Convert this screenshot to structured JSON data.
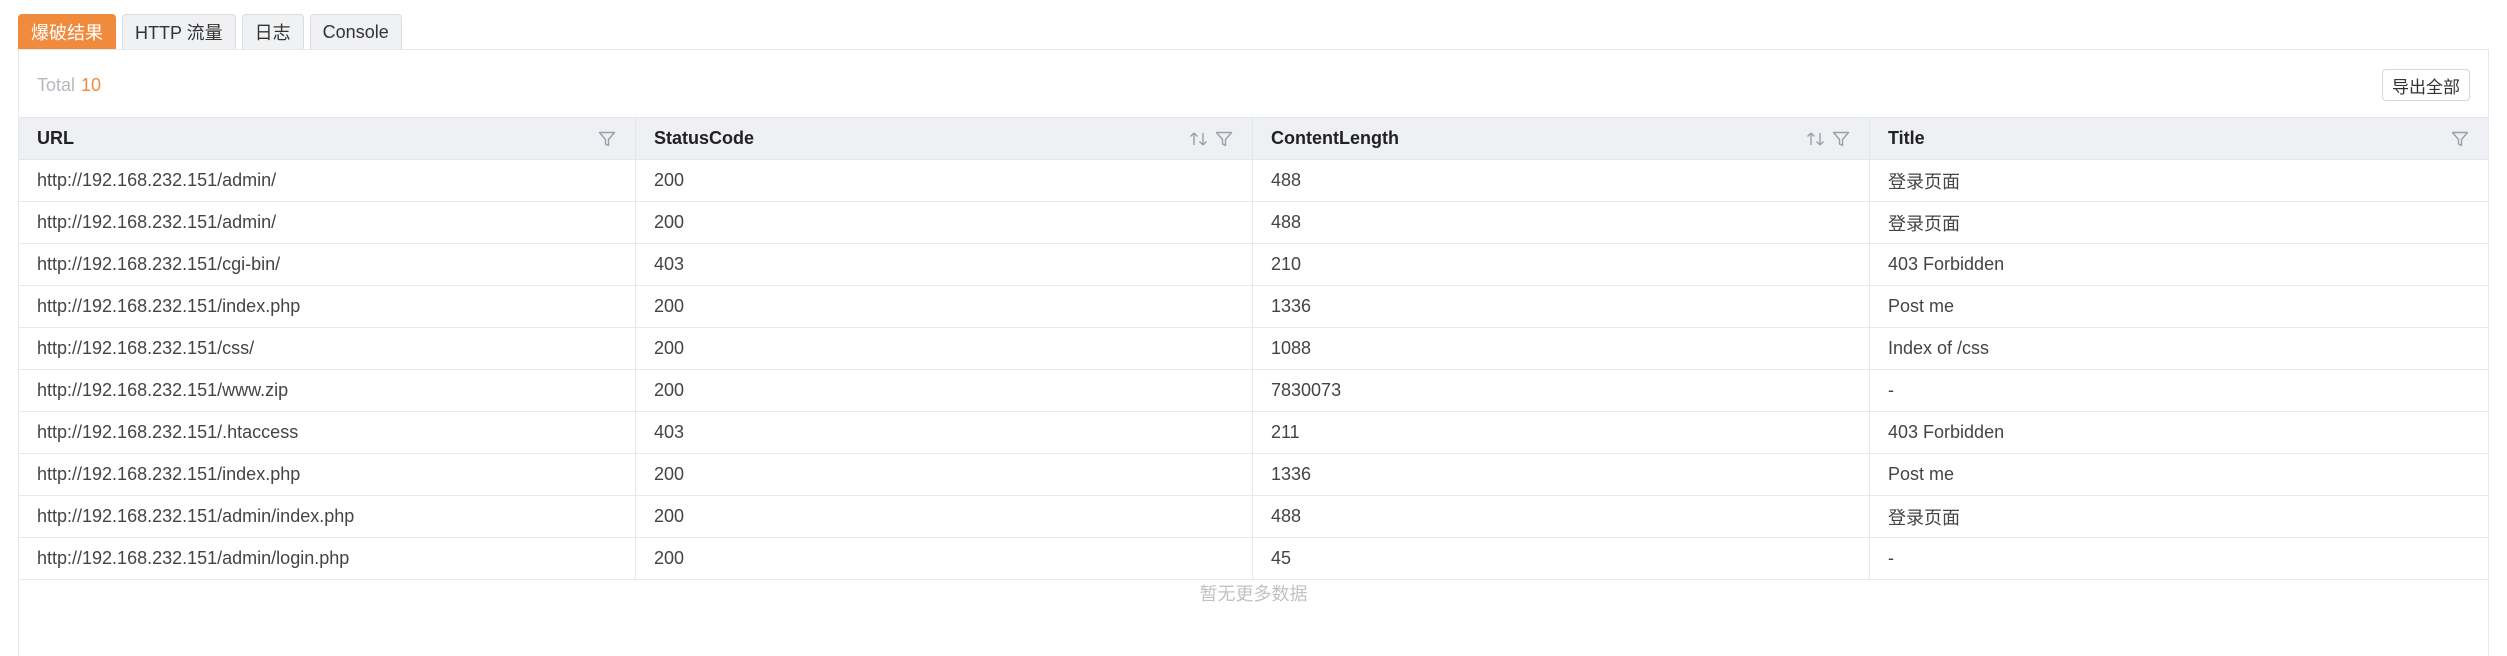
{
  "tabs": [
    {
      "label": "爆破结果",
      "active": true
    },
    {
      "label": "HTTP 流量",
      "active": false
    },
    {
      "label": "日志",
      "active": false
    },
    {
      "label": "Console",
      "active": false
    }
  ],
  "summary": {
    "total_label": "Total",
    "total_count": "10"
  },
  "toolbar": {
    "export_label": "导出全部"
  },
  "table": {
    "columns": [
      "URL",
      "StatusCode",
      "ContentLength",
      "Title"
    ],
    "rows": [
      [
        "http://192.168.232.151/admin/",
        "200",
        "488",
        "登录页面"
      ],
      [
        "http://192.168.232.151/admin/",
        "200",
        "488",
        "登录页面"
      ],
      [
        "http://192.168.232.151/cgi-bin/",
        "403",
        "210",
        "403 Forbidden"
      ],
      [
        "http://192.168.232.151/index.php",
        "200",
        "1336",
        "Post me"
      ],
      [
        "http://192.168.232.151/css/",
        "200",
        "1088",
        "Index of /css"
      ],
      [
        "http://192.168.232.151/www.zip",
        "200",
        "7830073",
        "-"
      ],
      [
        "http://192.168.232.151/.htaccess",
        "403",
        "211",
        "403 Forbidden"
      ],
      [
        "http://192.168.232.151/index.php",
        "200",
        "1336",
        "Post me"
      ],
      [
        "http://192.168.232.151/admin/index.php",
        "200",
        "488",
        "登录页面"
      ],
      [
        "http://192.168.232.151/admin/login.php",
        "200",
        "45",
        "-"
      ]
    ],
    "empty_note": "暂无更多数据"
  },
  "colors": {
    "accent": "#f08a3c",
    "header_bg": "#eef0f4",
    "muted": "#b5b8be"
  },
  "icons": {
    "filter": "filter-icon",
    "sort": "sort-icon"
  }
}
